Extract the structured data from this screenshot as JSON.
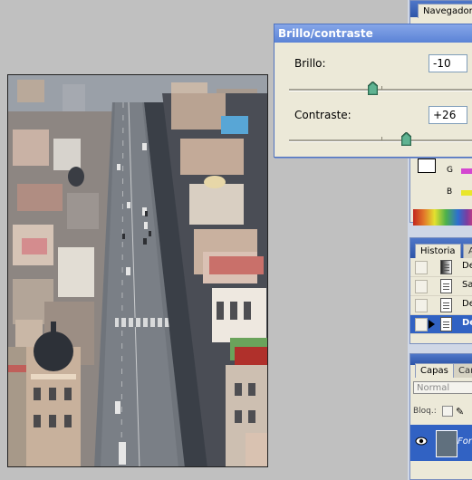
{
  "document_image": {
    "alt": "Vista aérea de una avenida con efecto miniatura"
  },
  "dialog": {
    "title": "Brillo/contraste",
    "brightness_label": "Brillo:",
    "brightness_value": "-10",
    "brightness_level": -10,
    "contrast_label": "Contraste:",
    "contrast_value": "+26",
    "contrast_level": 26
  },
  "navigator_palette": {
    "tab_label": "Navegador",
    "channels": [
      {
        "label": "G",
        "color": "#d447d0"
      },
      {
        "label": "B",
        "color": "#e9e62a"
      }
    ]
  },
  "history_palette": {
    "tabs": [
      "Historia",
      "Ac"
    ],
    "items": [
      {
        "label": "De",
        "selected": false
      },
      {
        "label": "Sa",
        "selected": false
      },
      {
        "label": "De",
        "selected": false
      },
      {
        "label": "De",
        "selected": true
      }
    ]
  },
  "layers_palette": {
    "tabs": [
      "Capas",
      "Can"
    ],
    "blend_mode": "Normal",
    "lock_label": "Bloq.:",
    "layer_name": "Fon"
  },
  "colors": {
    "titlebar": "#5b83d6",
    "selection": "#3162c3",
    "dialog_bg": "#ece9d8",
    "workspace": "#c0c0c0"
  }
}
